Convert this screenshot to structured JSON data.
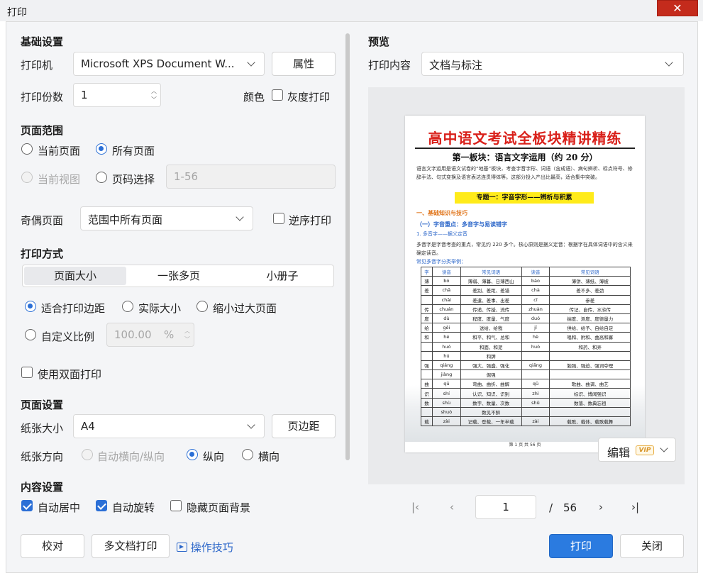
{
  "window": {
    "title": "打印",
    "close_glyph": "✕"
  },
  "left": {
    "basic_title": "基础设置",
    "printer_label": "打印机",
    "printer_value": "Microsoft XPS Document W...",
    "properties_button": "属性",
    "copies_label": "打印份数",
    "copies_value": "1",
    "color_label": "颜色",
    "grayscale_label": "灰度打印",
    "grayscale_checked": false,
    "range_title": "页面范围",
    "current_page": "当前页面",
    "all_pages": "所有页面",
    "current_view": "当前视图",
    "page_select": "页码选择",
    "page_range_placeholder": "1-56",
    "odd_even_label": "奇偶页面",
    "odd_even_value": "范围中所有页面",
    "reverse_label": "逆序打印",
    "reverse_checked": false,
    "mode_title": "打印方式",
    "mode_tabs": [
      "页面大小",
      "一张多页",
      "小册子"
    ],
    "fit_margins": "适合打印边距",
    "actual_size": "实际大小",
    "shrink_large": "缩小过大页面",
    "custom_scale": "自定义比例",
    "scale_value": "100.00",
    "scale_unit": "%",
    "duplex_label": "使用双面打印",
    "duplex_checked": false,
    "page_setup_title": "页面设置",
    "paper_size_label": "纸张大小",
    "paper_size_value": "A4",
    "margins_button": "页边距",
    "orientation_label": "纸张方向",
    "auto_orientation": "自动横向/纵向",
    "portrait": "纵向",
    "landscape": "横向",
    "content_title": "内容设置",
    "auto_center": "自动居中",
    "auto_center_checked": true,
    "auto_rotate": "自动旋转",
    "auto_rotate_checked": true,
    "hide_background": "隐藏页面背景",
    "hide_background_checked": false
  },
  "right": {
    "preview_title": "预览",
    "print_content_label": "打印内容",
    "print_content_value": "文档与标注",
    "edit_button": "编辑",
    "vip_badge": "VIP"
  },
  "doc": {
    "title": "高中语文考试全板块精讲精练",
    "h2": "第一板块：语言文字运用（约 20 分）",
    "para": "语言文字运用是语文试卷的“地基”板块，考查字音字形、词语（含成语）、病句辨析、标点符号、修辞手法、句式变换及语言表达连贯得体等。这部分投入产出比最高，适合集中突破。",
    "topic": "专题一：字音字形——辨析与积累",
    "o1": "一、基础知识与技巧",
    "o2": "（一）字音重点：多音字与易读错字",
    "o3": "1. 多音字——据义定音",
    "para2": "多音字是字音考查的重点，常见约 220 多个。核心原则是据义定音：根据字在具体词语中的含义来确定读音。",
    "table_caption": "常见多音字分类举例：",
    "table_head": [
      "字",
      "读音",
      "常见词语",
      "读音",
      "常见词语"
    ],
    "table_rows": [
      [
        "薄",
        "bó",
        "薄弱、薄暮、日薄西山",
        "báo",
        "薄饼、薄纸、薄被"
      ],
      [
        "差",
        "chā",
        "差别、差距、差错",
        "chà",
        "差不多、差劲"
      ],
      [
        "",
        "chāi",
        "差遣、差事、出差",
        "cī",
        "参差"
      ],
      [
        "传",
        "chuán",
        "传递、传授、流传",
        "zhuàn",
        "传记、自传、水浒传"
      ],
      [
        "度",
        "dù",
        "程度、度量、气度",
        "duó",
        "揣度、测度、度德量力"
      ],
      [
        "给",
        "gěi",
        "送给、给我",
        "jǐ",
        "供给、给予、自给自足"
      ],
      [
        "和",
        "hé",
        "和平、和气、总和",
        "hè",
        "唱和、附和、曲高和寡"
      ],
      [
        "",
        "huó",
        "和面、和泥",
        "huò",
        "和药、和弄"
      ],
      [
        "",
        "hú",
        "和牌",
        "",
        ""
      ],
      [
        "强",
        "qiáng",
        "强大、强盛、强化",
        "qiǎng",
        "勉强、强迫、强词夺理"
      ],
      [
        "",
        "jiàng",
        "倔强",
        "",
        ""
      ],
      [
        "曲",
        "qū",
        "弯曲、曲折、曲解",
        "qǔ",
        "歌曲、曲调、曲艺"
      ],
      [
        "识",
        "shí",
        "认识、知识、识别",
        "zhì",
        "标识、博闻强识"
      ],
      [
        "数",
        "shù",
        "数字、数量、次数",
        "shǔ",
        "数落、数典忘祖"
      ],
      [
        "",
        "shuò",
        "数见不鲜",
        "",
        ""
      ],
      [
        "载",
        "zài",
        "记载、登载、一年半载",
        "zài",
        "载歌、载体、载歌载舞"
      ]
    ],
    "footer": "第 1 页 共 56 页"
  },
  "pager": {
    "current": "1",
    "separator": "/",
    "total": "56"
  },
  "bottom": {
    "proofread_button": "校对",
    "multi_doc_button": "多文档打印",
    "tips_link": "操作技巧",
    "print_button": "打印",
    "close_button": "关闭"
  },
  "colors": {
    "accent": "#2b7be0",
    "close_red": "#c42b1c",
    "doc_title_red": "#d9201a",
    "highlight_yellow": "#ffeb1a"
  }
}
